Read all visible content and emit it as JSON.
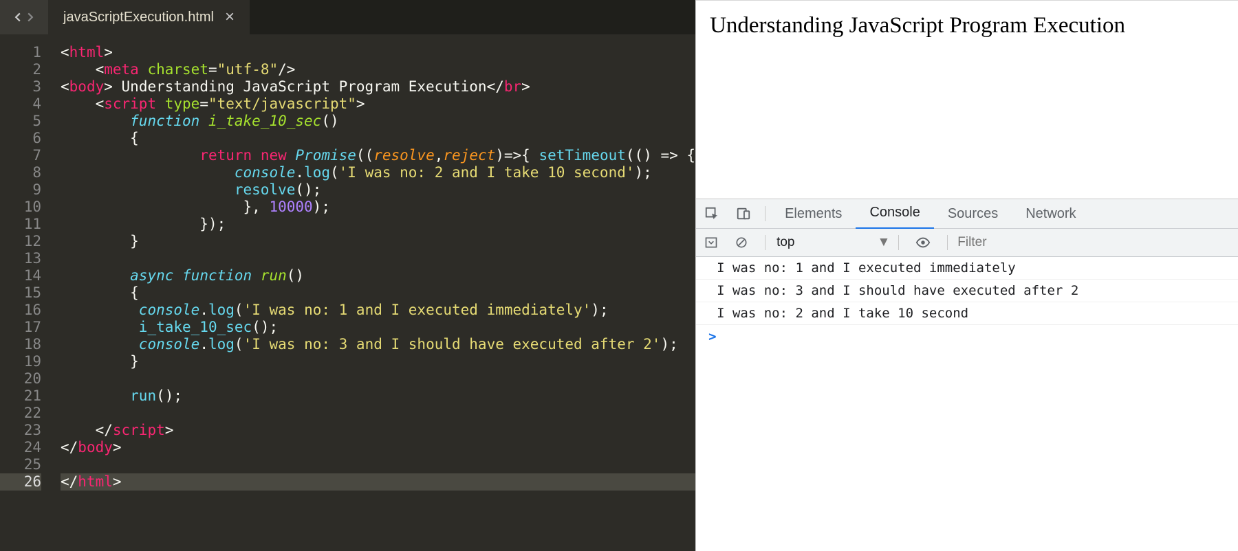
{
  "editor": {
    "tab_label": "javaScriptExecution.html",
    "line_count": 26,
    "highlighted_line": 26,
    "code": {
      "l1": {
        "indent": 0,
        "html_open": "<",
        "tag": "html",
        "close": ">"
      },
      "l2": {
        "indent": 1,
        "open": "<",
        "tag": "meta",
        "sp": " ",
        "attr": "charset",
        "eq": "=",
        "val": "\"utf-8\"",
        "selfclose": "/>"
      },
      "l3": {
        "indent": 0,
        "open": "<",
        "tag": "body",
        "close": "> ",
        "text": "Understanding JavaScript Program Execution",
        "open2": "</",
        "tag2": "br",
        "close2": ">"
      },
      "l4": {
        "indent": 1,
        "open": "<",
        "tag": "script",
        "sp": " ",
        "attr": "type",
        "eq": "=",
        "val": "\"text/javascript\"",
        "close": ">"
      },
      "l5": {
        "indent": 2,
        "kw": "function",
        "sp": " ",
        "name": "i_take_10_sec",
        "paren": "()"
      },
      "l6": {
        "indent": 2,
        "brace": "{"
      },
      "l7": {
        "indent": 4,
        "kw": "return",
        "sp": " ",
        "kw2": "new",
        "sp2": " ",
        "cls": "Promise",
        "open": "((",
        "p1": "resolve",
        "comma": ",",
        "p2": "reject",
        "arrow": ")=>{ ",
        "call": "setTimeout",
        "rest": "(() => {"
      },
      "l8": {
        "indent": 5,
        "obj": "console",
        "dot": ".",
        "method": "log",
        "paren": "(",
        "str": "'I was no: 2 and I take 10 second'",
        "end": ");"
      },
      "l9": {
        "indent": 5,
        "call": "resolve",
        "end": "();"
      },
      "l10": {
        "indent": 5,
        "endbrace": " }, ",
        "num": "10000",
        "end": ");"
      },
      "l11": {
        "indent": 4,
        "end": "});"
      },
      "l12": {
        "indent": 2,
        "brace": "}"
      },
      "l13": {
        "blank": true
      },
      "l14": {
        "indent": 2,
        "kw": "async",
        "sp": " ",
        "kw2": "function",
        "sp2": " ",
        "name": "run",
        "paren": "()"
      },
      "l15": {
        "indent": 2,
        "brace": "{"
      },
      "l16": {
        "indent": 2,
        "sp": " ",
        "obj": "console",
        "dot": ".",
        "method": "log",
        "paren": "(",
        "str": "'I was no: 1 and I executed immediately'",
        "end": ");"
      },
      "l17": {
        "indent": 2,
        "sp": " ",
        "call": "i_take_10_sec",
        "end": "();"
      },
      "l18": {
        "indent": 2,
        "sp": " ",
        "obj": "console",
        "dot": ".",
        "method": "log",
        "paren": "(",
        "str": "'I was no: 3 and I should have executed after 2'",
        "end": ");"
      },
      "l19": {
        "indent": 2,
        "brace": "}"
      },
      "l20": {
        "blank": true
      },
      "l21": {
        "indent": 2,
        "call": "run",
        "end": "();"
      },
      "l22": {
        "blank": true
      },
      "l23": {
        "indent": 1,
        "open": "</",
        "tag": "script",
        "close": ">"
      },
      "l24": {
        "indent": 0,
        "open": "</",
        "tag": "body",
        "close": ">"
      },
      "l25": {
        "blank": true
      },
      "l26": {
        "indent": 0,
        "open": "</",
        "tag": "html",
        "close": ">"
      }
    }
  },
  "page": {
    "heading": "Understanding JavaScript Program Execution"
  },
  "devtools": {
    "tabs": [
      "Elements",
      "Console",
      "Sources",
      "Network"
    ],
    "active_tab": "Console",
    "context_label": "top",
    "filter_placeholder": "Filter",
    "console": [
      "I was no: 1 and I executed immediately",
      "I was no: 3 and I should have executed after 2",
      "I was no: 2 and I take 10 second"
    ],
    "prompt": ">"
  }
}
